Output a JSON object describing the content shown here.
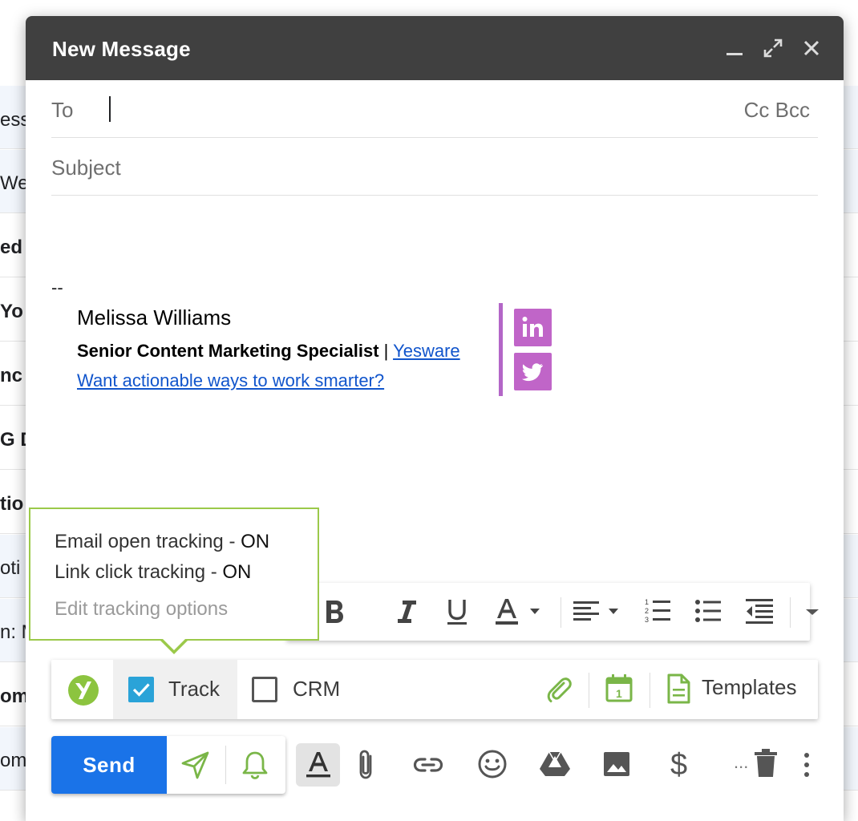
{
  "inbox_rows": [
    {
      "text": "ess",
      "bold": false
    },
    {
      "text": " We",
      "bold": false
    },
    {
      "text": "ed",
      "bold": true
    },
    {
      "text": "Yo",
      "bold": true
    },
    {
      "text": "nc",
      "bold": true
    },
    {
      "text": "G D",
      "bold": true
    },
    {
      "text": "tio",
      "bold": true
    },
    {
      "text": "oti",
      "bold": false
    },
    {
      "text": "n: M",
      "bold": false
    },
    {
      "text": "om",
      "bold": true
    },
    {
      "text": "om",
      "bold": false
    }
  ],
  "compose": {
    "title": "New Message",
    "to_label": "To",
    "cc_bcc": "Cc Bcc",
    "subject_placeholder": "Subject"
  },
  "signature": {
    "dash": "--",
    "name": "Melissa Williams",
    "title": "Senior Content Marketing Specialist",
    "separator": " | ",
    "company": "Yesware",
    "tagline_link": "Want actionable ways to work smarter?",
    "social": [
      "linkedin-icon",
      "twitter-icon"
    ],
    "accent_color": "#c065c8"
  },
  "tooltip": {
    "open_tracking_label": "Email open tracking - ",
    "open_tracking_state": "ON",
    "link_tracking_label": "Link click tracking - ",
    "link_tracking_state": "ON",
    "edit_link": "Edit tracking options",
    "border_color": "#9bc94a"
  },
  "yesware_bar": {
    "track_label": "Track",
    "track_checked": true,
    "crm_label": "CRM",
    "crm_checked": false,
    "templates_label": "Templates"
  },
  "bottom_bar": {
    "send_label": "Send",
    "more_label": "..."
  },
  "colors": {
    "header": "#404040",
    "send": "#1a73e8",
    "yesware_green": "#7ab648",
    "checkbox_blue": "#2aa3d8"
  }
}
